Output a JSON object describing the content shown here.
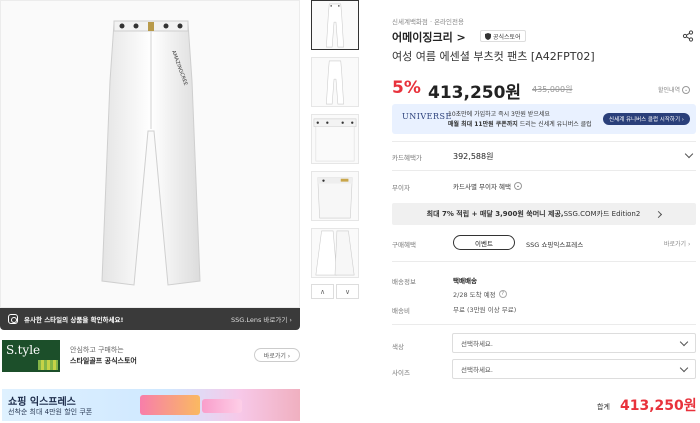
{
  "gallery": {
    "lens_text": "유사한 스타일의 상품을 확인하세요!",
    "lens_link": "SSG.Lens 바로가기 ›",
    "thumbnails": 5,
    "prev_arrow": "∧",
    "next_arrow": "∨"
  },
  "store": {
    "logo_text": "S.tyle",
    "sub": "안심하고 구매하는",
    "main": "스타일골프 공식스토어",
    "button": "바로가기 ›"
  },
  "express": {
    "title": "쇼핑 익스프레스",
    "subtitle": "선착순 최대 4만원 할인 쿠폰"
  },
  "product": {
    "breadcrumb": "신세계백화점 · 온라인전용",
    "brand": "어메이징크리 >",
    "official_badge": "공식스토어",
    "title": "여성 여름 에센셜 부츠컷 팬츠 [A42FPT02]",
    "discount": "5%",
    "price": "413,250원",
    "original_price": "435,000원",
    "discount_info": "할인내역"
  },
  "universe": {
    "logo": "UNIVERSE",
    "line1": "10초만에 가입하고 즉시 3만원 받으세요",
    "line2_bold": "매월 최대 11만원 쿠폰까지",
    "line2_rest": " 드리는 신세계 유니버스 클럽",
    "button": "신세계 유니버스 클럽 시작하기 ›"
  },
  "card_price": {
    "label": "카드혜택가",
    "value": "392,588원"
  },
  "interest_free": {
    "label": "무이자",
    "value": "카드사별 무이자 혜택"
  },
  "promo": {
    "bold": "최대 7% 적립 + 매달 3,900원 쑥머니 제공,",
    "rest": " SSG.COM카드 Edition2"
  },
  "purchase_benefit": {
    "label": "구매혜택",
    "button": "이벤트",
    "text": "SSG 쇼핑익스프레스",
    "more": "바로가기 ›"
  },
  "shipping": {
    "label": "배송정보",
    "method": "택배배송",
    "eta": "2/28 도착 예정",
    "fee_label": "배송비",
    "fee": "무료 (3만원 이상 무료)"
  },
  "options": [
    {
      "label": "색상",
      "placeholder": "선택하세요."
    },
    {
      "label": "사이즈",
      "placeholder": "선택하세요."
    }
  ],
  "total": {
    "label": "합계",
    "value": "413,250원"
  },
  "colors": {
    "sale_red": "#e8323c",
    "universe_navy": "#2a3f7a"
  }
}
